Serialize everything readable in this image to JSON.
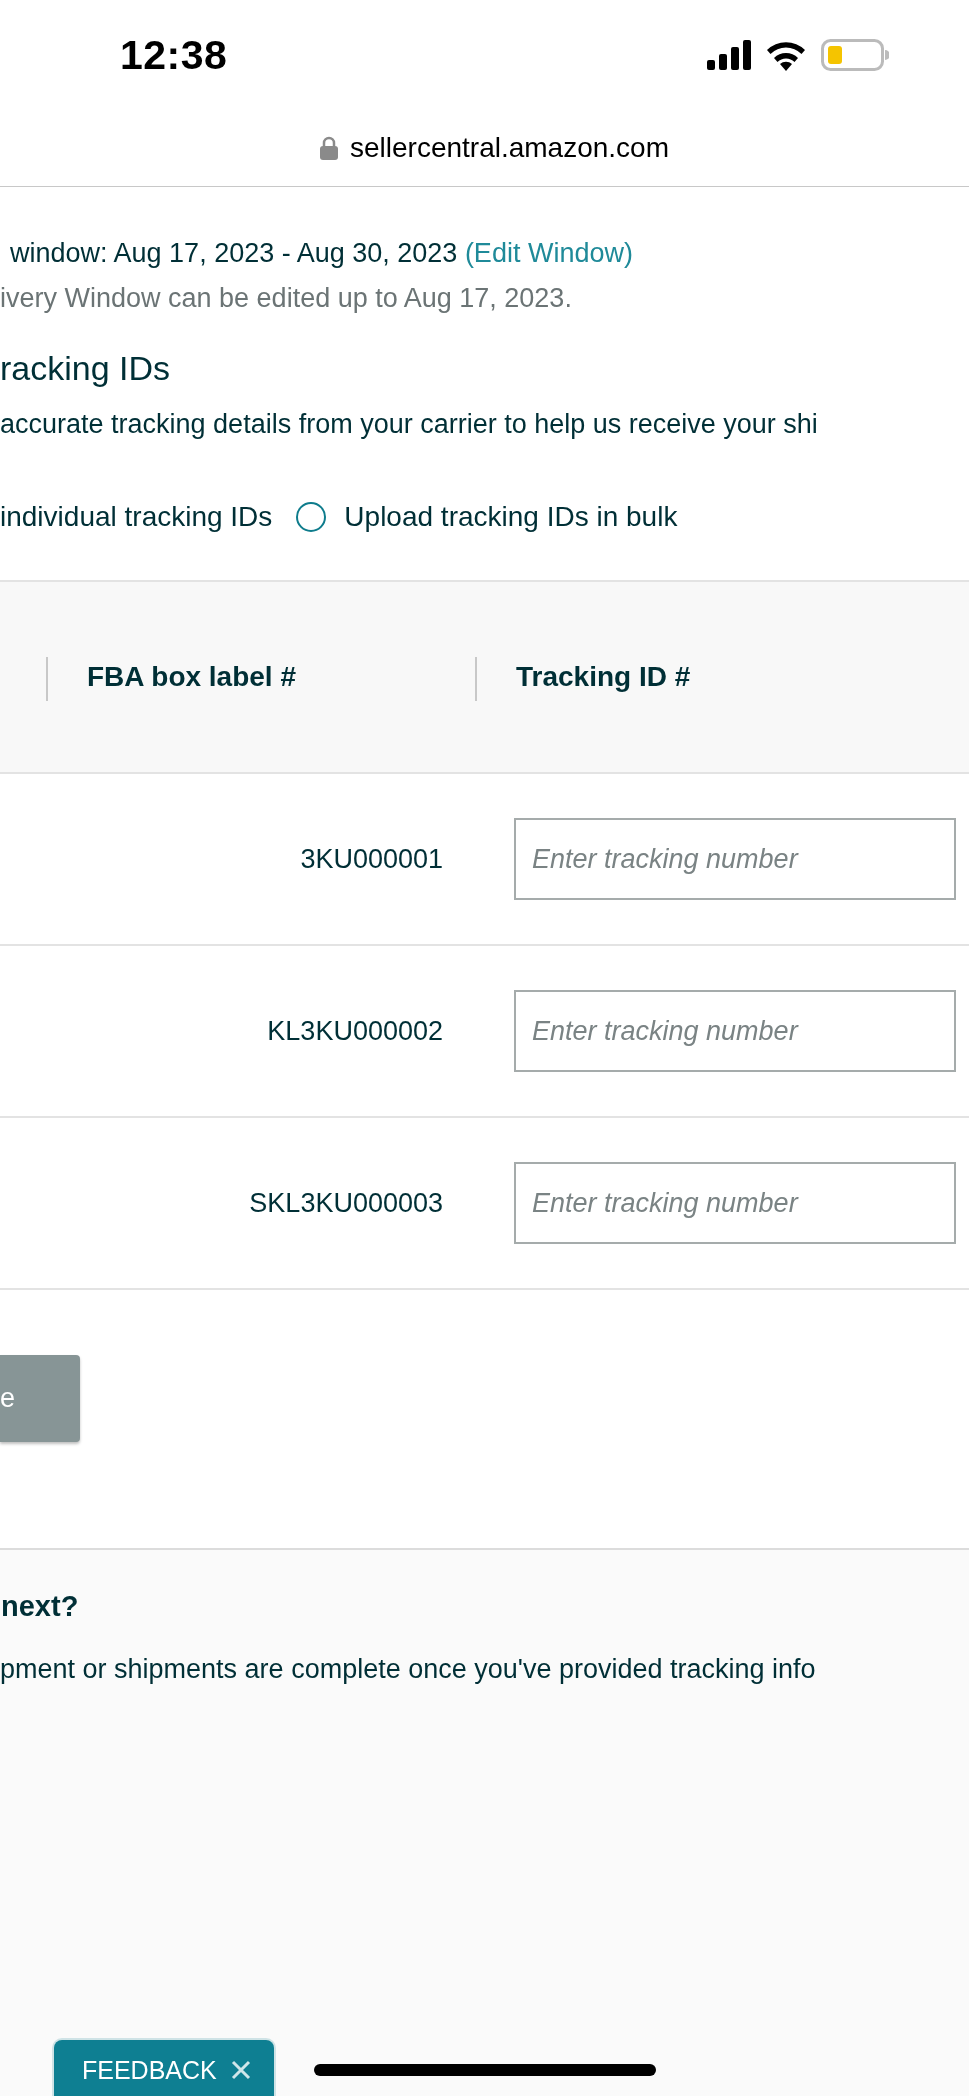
{
  "status_bar": {
    "time": "12:38"
  },
  "address_bar": {
    "url": "sellercentral.amazon.com"
  },
  "delivery_window": {
    "text": "window: Aug 17, 2023 - Aug 30, 2023",
    "link": "(Edit Window)",
    "note": "ivery Window can be edited up to Aug 17, 2023."
  },
  "section": {
    "heading": "racking IDs",
    "description": "accurate tracking details from your carrier to help us receive your shi"
  },
  "entry_options": [
    {
      "label": "individual tracking IDs"
    },
    {
      "label": "Upload tracking IDs in bulk",
      "selected": false
    }
  ],
  "table": {
    "columns": [
      "FBA box label #",
      "Tracking ID #"
    ],
    "rows": [
      {
        "box_label": "3KU000001",
        "tracking_placeholder": "Enter tracking number"
      },
      {
        "box_label": "KL3KU000002",
        "tracking_placeholder": "Enter tracking number"
      },
      {
        "box_label": "SKL3KU000003",
        "tracking_placeholder": "Enter tracking number"
      }
    ]
  },
  "button": {
    "label": "e",
    "disabled": true
  },
  "next_steps": {
    "heading": "next?",
    "text": "pment or shipments are complete once you've provided tracking info"
  },
  "feedback": {
    "label": "FEEDBACK"
  }
}
